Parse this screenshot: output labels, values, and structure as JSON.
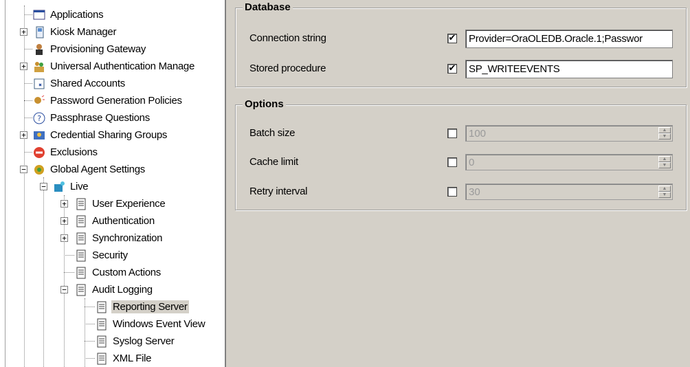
{
  "tree": {
    "items": [
      {
        "label": "Applications"
      },
      {
        "label": "Kiosk Manager"
      },
      {
        "label": "Provisioning Gateway"
      },
      {
        "label": "Universal Authentication Manage"
      },
      {
        "label": "Shared Accounts"
      },
      {
        "label": "Password Generation Policies"
      },
      {
        "label": "Passphrase Questions"
      },
      {
        "label": "Credential Sharing Groups"
      },
      {
        "label": "Exclusions"
      },
      {
        "label": "Global Agent Settings"
      },
      {
        "label": "Live"
      },
      {
        "label": "User Experience"
      },
      {
        "label": "Authentication"
      },
      {
        "label": "Synchronization"
      },
      {
        "label": "Security"
      },
      {
        "label": "Custom Actions"
      },
      {
        "label": "Audit Logging"
      },
      {
        "label": "Reporting Server"
      },
      {
        "label": "Windows Event View"
      },
      {
        "label": "Syslog Server"
      },
      {
        "label": "XML File"
      }
    ]
  },
  "database": {
    "title": "Database",
    "connection_string": {
      "label": "Connection string",
      "checked": true,
      "value": "Provider=OraOLEDB.Oracle.1;Passwor"
    },
    "stored_procedure": {
      "label": "Stored procedure",
      "checked": true,
      "value": "SP_WRITEEVENTS"
    }
  },
  "options": {
    "title": "Options",
    "batch_size": {
      "label": "Batch size",
      "checked": false,
      "value": "100"
    },
    "cache_limit": {
      "label": "Cache limit",
      "checked": false,
      "value": "0"
    },
    "retry_interval": {
      "label": "Retry interval",
      "checked": false,
      "value": "30"
    }
  },
  "glyphs": {
    "check": "✔",
    "up": "▲",
    "down": "▼",
    "plus": "+",
    "minus": "−"
  },
  "colors": {
    "panel_bg": "#d4d0c8",
    "tree_bg": "#ffffff",
    "disabled_text": "#9a9a9a"
  }
}
